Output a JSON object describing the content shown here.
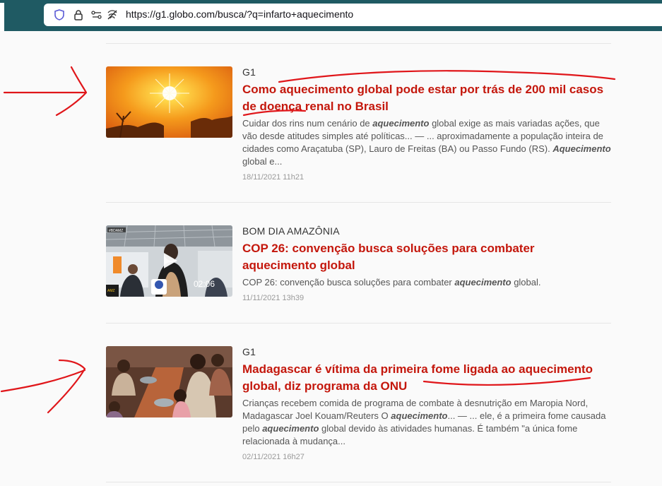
{
  "browser": {
    "url": "https://g1.globo.com/busca/?q=infarto+aquecimento"
  },
  "results": [
    {
      "section": "G1",
      "title": "Como aquecimento global pode estar por trás de 200 mil casos de doença renal no Brasil",
      "snippet_parts": [
        {
          "t": "Cuidar dos rins num cenário de ",
          "b": false
        },
        {
          "t": "aquecimento",
          "b": true
        },
        {
          "t": " global exige as mais variadas ações, que vão desde atitudes simples até políticas... — ... aproximadamente a população inteira de cidades como Araçatuba (SP), Lauro de Freitas (BA) ou Passo Fundo (RS). ",
          "b": false
        },
        {
          "t": "Aquecimento",
          "b": true
        },
        {
          "t": " global e...",
          "b": false
        }
      ],
      "date": "18/11/2021 11h21",
      "thumb": "sun-image"
    },
    {
      "section": "BOM DIA AMAZÔNIA",
      "title": "COP 26: convenção busca soluções para combater aquecimento global",
      "snippet_parts": [
        {
          "t": "COP 26: convenção busca soluções para combater ",
          "b": false
        },
        {
          "t": "aquecimento",
          "b": true
        },
        {
          "t": " global.",
          "b": false
        }
      ],
      "date": "11/11/2021 13h39",
      "thumb": "video-thumbnail",
      "duration": "02:06",
      "video_tag": "#BDAMZ",
      "mic_label": "AMZ"
    },
    {
      "section": "G1",
      "title": "Madagascar é vítima da primeira fome ligada ao aquecimento global, diz programa da ONU",
      "snippet_parts": [
        {
          "t": "Crianças recebem comida de programa de combate à desnutrição em Maropia Nord, Madagascar Joel Kouam/Reuters O ",
          "b": false
        },
        {
          "t": "aquecimento",
          "b": true
        },
        {
          "t": "... — ... ele, é a primeira fome causada pelo ",
          "b": false
        },
        {
          "t": "aquecimento",
          "b": true
        },
        {
          "t": " global devido às atividades humanas. É também \"a única fome relacionada à mudança...",
          "b": false
        }
      ],
      "date": "02/11/2021 16h27",
      "thumb": "children-eating-image"
    }
  ],
  "colors": {
    "title_red": "#c4170c",
    "annotation_red": "#e0161a",
    "toolbar": "#1f5a63"
  }
}
